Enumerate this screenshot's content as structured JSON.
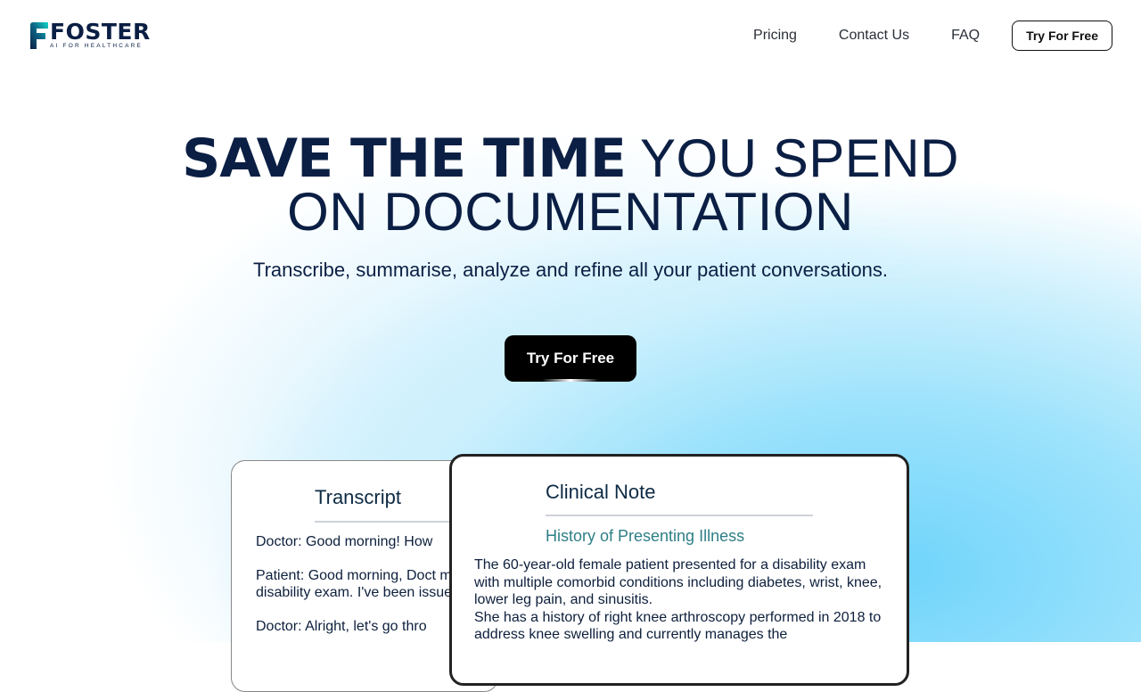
{
  "brand": {
    "name": "FOSTER",
    "tagline": "AI FOR HEALTHCARE",
    "gradient_start": "#15d6c4",
    "gradient_end": "#0b1f44"
  },
  "nav": {
    "links": [
      "Pricing",
      "Contact Us",
      "FAQ"
    ],
    "cta_label": "Try For Free"
  },
  "hero": {
    "title_bold": "SAVE THE TIME",
    "title_rest_line1": "YOU SPEND",
    "title_line2": "ON DOCUMENTATION",
    "subtitle": "Transcribe, summarise, analyze and refine all your patient conversations.",
    "cta_label": "Try For Free"
  },
  "transcript": {
    "title": "Transcript",
    "lines": [
      "Doctor: Good morning! How",
      "Patient: Good morning, Doct my disability exam. I've been issues.",
      "Doctor: Alright, let's go thro"
    ]
  },
  "clinical_note": {
    "title": "Clinical Note",
    "section_title": "History of Presenting Illness",
    "paragraphs": [
      "The 60-year-old female patient presented for a disability exam with multiple comorbid conditions including diabetes, wrist, knee, lower leg pain, and sinusitis.",
      "She has a history of right knee arthroscopy performed in 2018 to address knee swelling and currently manages the"
    ]
  },
  "colors": {
    "navy": "#0b1f44",
    "accent_teal": "#2e7f86",
    "cta_black": "#000000",
    "sky_blue": "#6fd4fb"
  }
}
